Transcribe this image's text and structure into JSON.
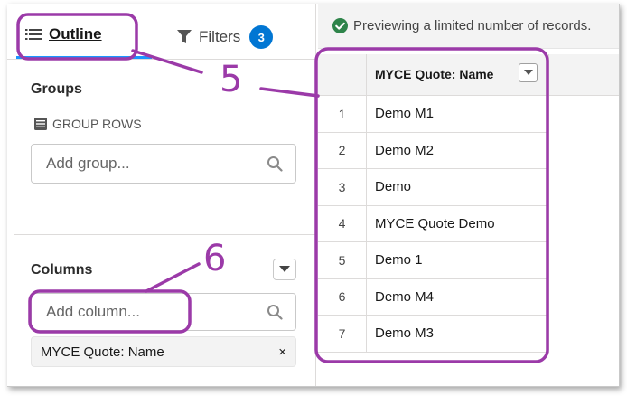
{
  "tabs": {
    "outline_label": "Outline",
    "filters_label": "Filters",
    "filters_count": "3"
  },
  "groups": {
    "title": "Groups",
    "group_rows_label": "GROUP ROWS",
    "search_placeholder": "Add group..."
  },
  "columns": {
    "title": "Columns",
    "search_placeholder": "Add column...",
    "selected": [
      {
        "label": "MYCE Quote: Name",
        "remove": "×"
      }
    ]
  },
  "preview": {
    "message": "Previewing a limited number of records."
  },
  "grid": {
    "column_header": "MYCE Quote: Name",
    "rows": [
      {
        "num": "1",
        "name": "Demo M1"
      },
      {
        "num": "2",
        "name": "Demo M2"
      },
      {
        "num": "3",
        "name": "Demo"
      },
      {
        "num": "4",
        "name": "MYCE Quote Demo"
      },
      {
        "num": "5",
        "name": "Demo 1"
      },
      {
        "num": "6",
        "name": "Demo M4"
      },
      {
        "num": "7",
        "name": "Demo M3"
      }
    ]
  },
  "annotations": {
    "label_5": "5",
    "label_6": "6",
    "color": "#9b3aa8"
  },
  "icons": {
    "outline": "list-icon",
    "filters": "filter-icon",
    "group_rows": "table-icon",
    "search": "search-icon",
    "success": "check-circle-icon",
    "dropdown": "chevron-down-icon",
    "remove": "close-icon"
  },
  "colors": {
    "accent": "#0176d3",
    "tab_underline": "#1b96ff",
    "success": "#2e844a"
  }
}
